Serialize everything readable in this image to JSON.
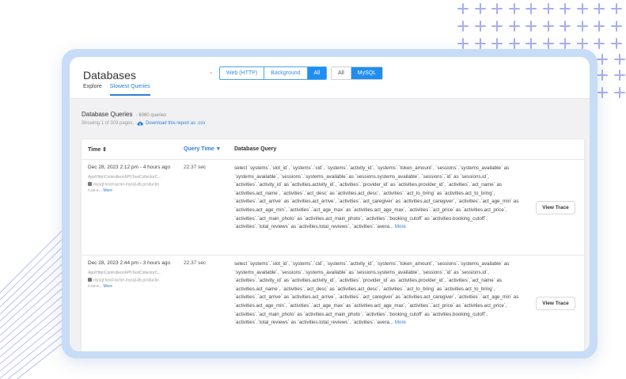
{
  "header": {
    "title": "Databases",
    "separator": "-",
    "source_filter": {
      "options": [
        "Web (HTTP)",
        "Background",
        "All"
      ],
      "selected": "All"
    },
    "engine_filter": {
      "options": [
        "All",
        "MySQL"
      ],
      "selected": "MySQL"
    }
  },
  "tabs": [
    {
      "label": "Explore",
      "active": false
    },
    {
      "label": "Slowest Queries",
      "active": true
    }
  ],
  "panel": {
    "title": "Database Queries",
    "count": "· 6060 queries",
    "showing": "Showing 1 of 303 pages.",
    "download": "Download this report as .csv"
  },
  "table": {
    "columns": {
      "time": "Time ⇕",
      "query_time": "Query Time ▼",
      "query": "Database Query"
    },
    "rows": [
      {
        "timestamp": "Dec 28, 2023 2:12 pm - 4 hours ago",
        "controller": "App\\Http\\Controllers\\API\\TestCollectorC...",
        "host_prefix": "mysql:host=acme-mysql-db.productio",
        "host_suffix": "n.us-e...",
        "more": "More",
        "query_time": "22.37 sec",
        "sql": "select `systems`.`slot_id`, `systems`.`cid`, `systems`.`activity_id`, `systems`.`token_amount`, `sessions`.`systems_available` as `systems_available`, `sessions`.`systems_available` as `sessions.systems_available`, `sessions`.`id` as `sessions.id`, `activities`.`activity_id` as `activities.activity_id`, `activities`.`provider_id` as `activities.provider_id`, `activities`.`act_name` as `activities.act_name`, `activities`.`act_desc` as `activities.act_desc`, `activities`.`act_to_bring` as `activities.act_to_bring`, `activities`.`act_arrive` as `activities.act_arrive`, `activities`.`act_caregiver` as `activities.act_caregiver`, `activities`.`act_age_min` as `activities.act_age_min`, `activities`.`act_age_max` as `activities.act_age_max`, `activities`.`act_price` as `activities.act_price`, `activities`.`act_main_photo` as `activities.act_main_photo`, `activities`.`booking_cutoff` as `activities.booking_cutoff`, `activities`.`total_reviews` as `activities.total_reviews`, `activities`.`avera...",
        "sql_more": "More",
        "button": "View Trace"
      },
      {
        "timestamp": "Dec 28, 2023 2:44 pm - 3 hours ago",
        "controller": "App\\Http\\Controllers\\API\\TestCollectorC...",
        "host_prefix": "mysql:host=acme-mysql-db.productio",
        "host_suffix": "n.us-e...",
        "more": "More",
        "query_time": "22.37 sec",
        "sql": "select `systems`.`slot_id`, `systems`.`cid`, `systems`.`activity_id`, `systems`.`token_amount`, `sessions`.`systems_available` as `systems_available`, `sessions`.`systems_available` as `sessions.systems_available`, `sessions`.`id` as `sessions.id`, `activities`.`activity_id` as `activities.activity_id`, `activities`.`provider_id` as `activities.provider_id`, `activities`.`act_name` as `activities.act_name`, `activities`.`act_desc` as `activities.act_desc`, `activities`.`act_to_bring` as `activities.act_to_bring`, `activities`.`act_arrive` as `activities.act_arrive`, `activities`.`act_caregiver` as `activities.act_caregiver`, `activities`.`act_age_min` as `activities.act_age_min`, `activities`.`act_age_max` as `activities.act_age_max`, `activities`.`act_price` as `activities.act_price`, `activities`.`act_main_photo` as `activities.act_main_photo`, `activities`.`booking_cutoff` as `activities.booking_cutoff`, `activities`.`total_reviews` as `activities.total_reviews`, `activities`.`avera...",
        "sql_more": "More",
        "button": "View Trace"
      }
    ]
  },
  "colors": {
    "accent": "#1f8ef1",
    "link": "#2d7fd6",
    "card_border": "#c7dcf7",
    "decor": "#a7aef4"
  }
}
